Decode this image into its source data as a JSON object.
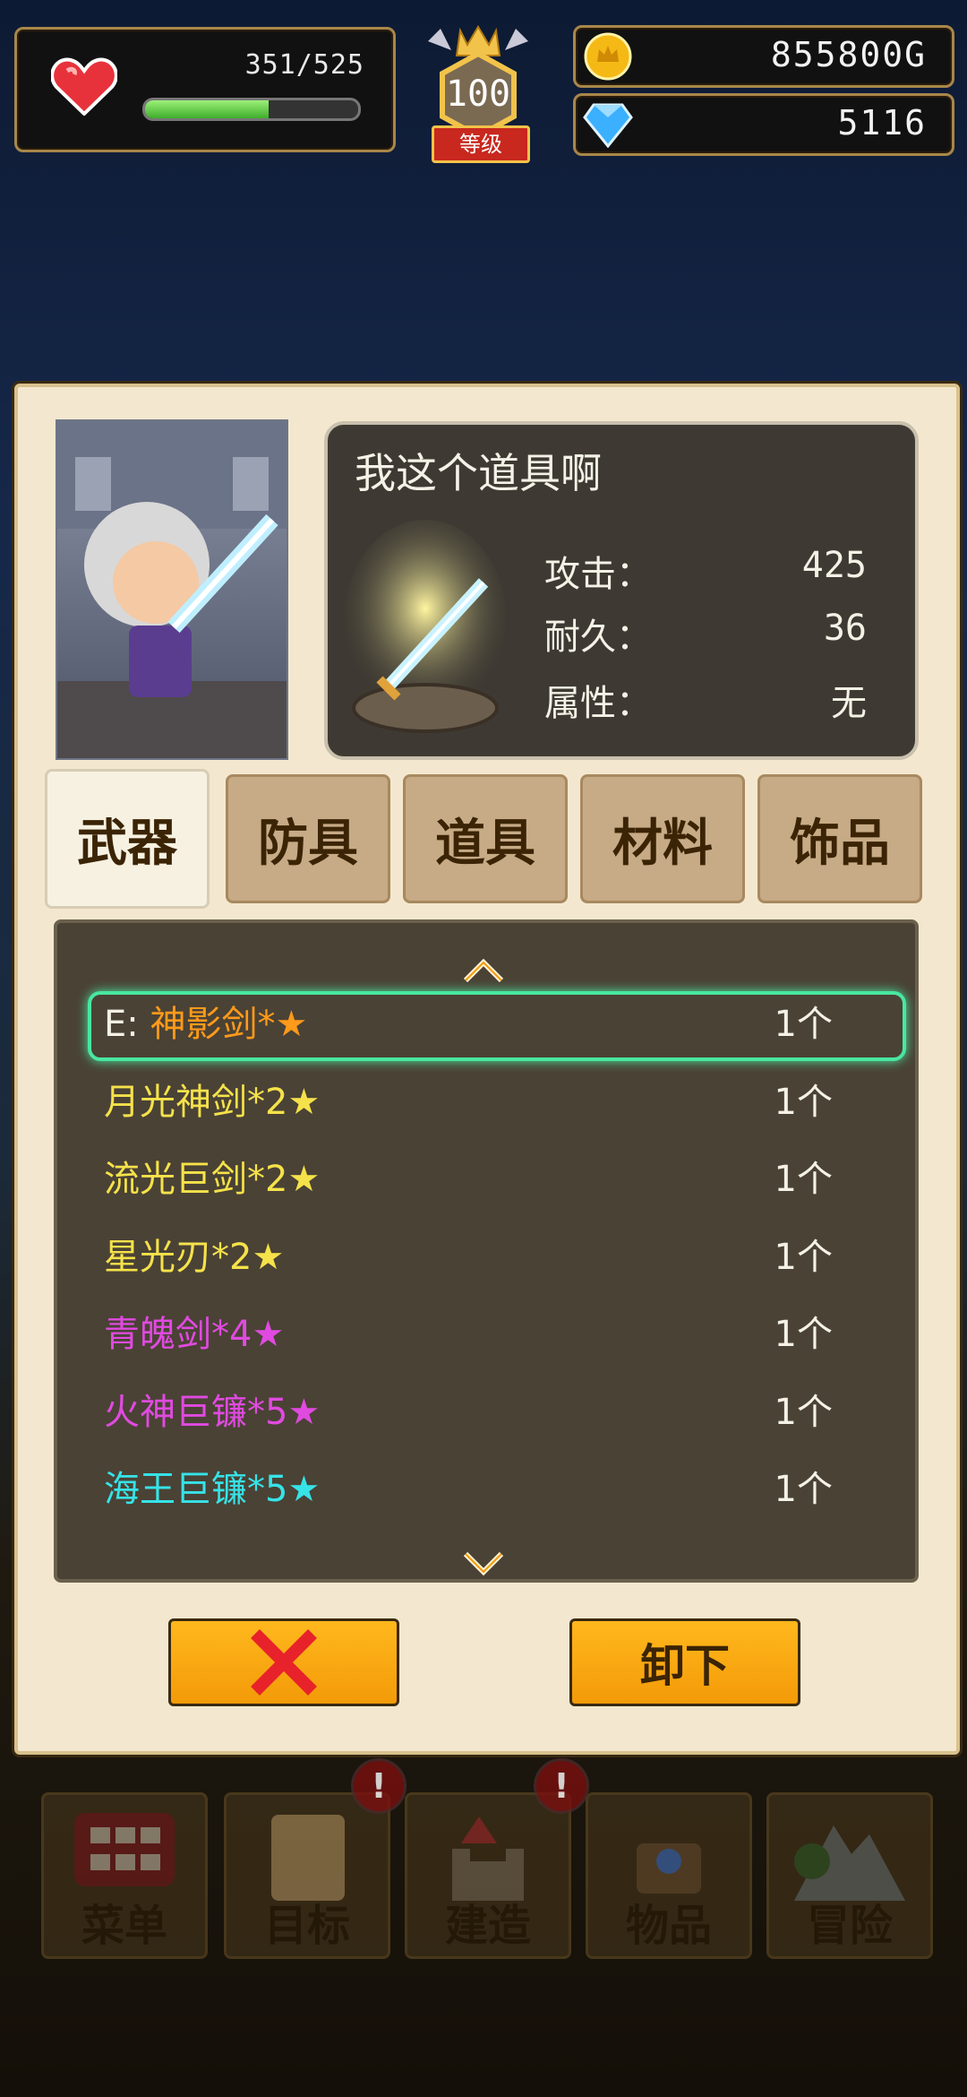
{
  "hud": {
    "hp": "351/525",
    "hp_fraction": 0.58,
    "level": "100",
    "level_label": "等级",
    "gold": "855800G",
    "gems": "5116"
  },
  "item_detail": {
    "title": "我这个道具啊",
    "stats": [
      {
        "label": "攻击：",
        "value": "425"
      },
      {
        "label": "耐久：",
        "value": "36"
      },
      {
        "label": "属性：",
        "value": "无"
      }
    ]
  },
  "tabs": [
    "武器",
    "防具",
    "道具",
    "材料",
    "饰品"
  ],
  "active_tab": 0,
  "items": [
    {
      "prefix": "E: ",
      "name": "神影剑*★",
      "count": "1个",
      "color": "#ff9a1a",
      "equipped": true
    },
    {
      "prefix": "",
      "name": "月光神剑*2★",
      "count": "1个",
      "color": "#f5e24a"
    },
    {
      "prefix": "",
      "name": "流光巨剑*2★",
      "count": "1个",
      "color": "#f5e24a"
    },
    {
      "prefix": "",
      "name": "星光刃*2★",
      "count": "1个",
      "color": "#f5e24a"
    },
    {
      "prefix": "",
      "name": "青魄剑*4★",
      "count": "1个",
      "color": "#e04ae0"
    },
    {
      "prefix": "",
      "name": "火神巨镰*5★",
      "count": "1个",
      "color": "#e04ae0"
    },
    {
      "prefix": "",
      "name": "海王巨镰*5★",
      "count": "1个",
      "color": "#36e3e8"
    }
  ],
  "buttons": {
    "close_icon": "close-x-icon",
    "unequip": "卸下"
  },
  "menu": [
    "菜单",
    "目标",
    "建造",
    "物品",
    "冒险"
  ],
  "colors": {
    "accent": "#f39a08",
    "selection": "#49e7a0"
  }
}
